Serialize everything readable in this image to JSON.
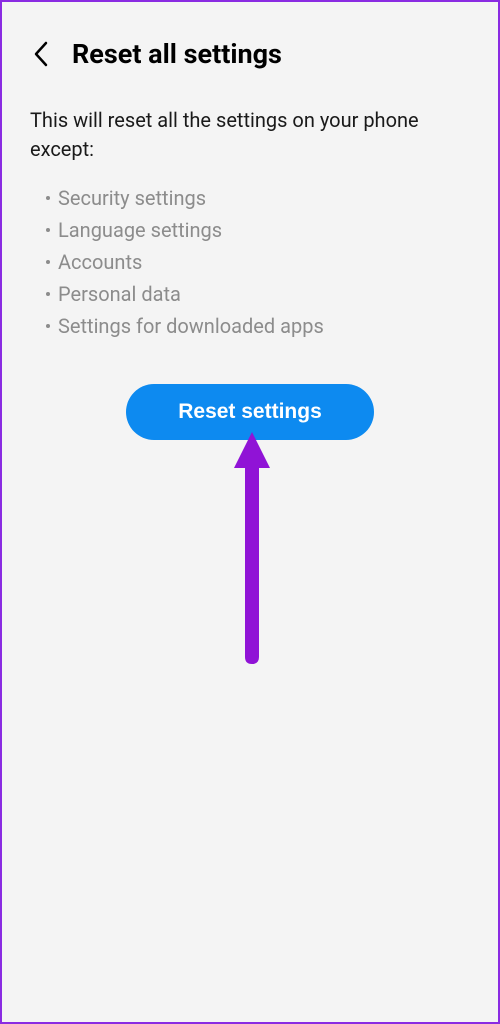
{
  "header": {
    "title": "Reset all settings"
  },
  "main": {
    "description": "This will reset all the settings on your phone except:",
    "exceptions": [
      "Security settings",
      "Language settings",
      "Accounts",
      "Personal data",
      "Settings for downloaded apps"
    ],
    "button_label": "Reset settings"
  },
  "colors": {
    "accent": "#0d8af0",
    "annotation": "#9013d6",
    "border": "#8a2be2"
  }
}
